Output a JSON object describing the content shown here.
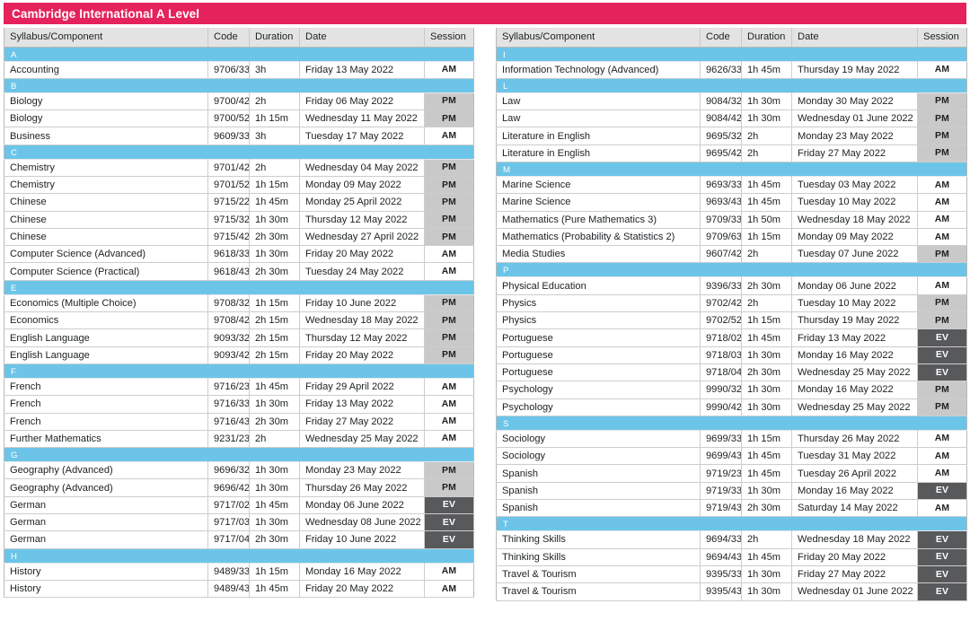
{
  "header": {
    "title": "Cambridge International A Level",
    "accent_pink": "#e5225b",
    "band_blue": "#6cc5e8",
    "session_pm_bg": "#c9c9c9",
    "session_ev_bg": "#58595b"
  },
  "columns": [
    "Syllabus/Component",
    "Code",
    "Duration",
    "Date",
    "Session"
  ],
  "left_table": {
    "sections": [
      {
        "letter": "A",
        "rows": [
          {
            "syllabus": "Accounting",
            "code": "9706/33",
            "duration": "3h",
            "date": "Friday 13 May 2022",
            "session": "AM"
          }
        ]
      },
      {
        "letter": "B",
        "rows": [
          {
            "syllabus": "Biology",
            "code": "9700/42",
            "duration": "2h",
            "date": "Friday 06 May 2022",
            "session": "PM"
          },
          {
            "syllabus": "Biology",
            "code": "9700/52",
            "duration": "1h 15m",
            "date": "Wednesday 11 May 2022",
            "session": "PM"
          },
          {
            "syllabus": "Business",
            "code": "9609/33",
            "duration": "3h",
            "date": "Tuesday 17 May 2022",
            "session": "AM"
          }
        ]
      },
      {
        "letter": "C",
        "rows": [
          {
            "syllabus": "Chemistry",
            "code": "9701/42",
            "duration": "2h",
            "date": "Wednesday 04 May 2022",
            "session": "PM"
          },
          {
            "syllabus": "Chemistry",
            "code": "9701/52",
            "duration": "1h 15m",
            "date": "Monday 09 May 2022",
            "session": "PM"
          },
          {
            "syllabus": "Chinese",
            "code": "9715/22",
            "duration": "1h 45m",
            "date": "Monday 25 April 2022",
            "session": "PM"
          },
          {
            "syllabus": "Chinese",
            "code": "9715/32",
            "duration": "1h 30m",
            "date": "Thursday 12 May 2022",
            "session": "PM"
          },
          {
            "syllabus": "Chinese",
            "code": "9715/42",
            "duration": "2h 30m",
            "date": "Wednesday 27 April 2022",
            "session": "PM"
          },
          {
            "syllabus": "Computer Science (Advanced)",
            "code": "9618/33",
            "duration": "1h 30m",
            "date": "Friday 20 May 2022",
            "session": "AM"
          },
          {
            "syllabus": "Computer Science (Practical)",
            "code": "9618/43",
            "duration": "2h 30m",
            "date": "Tuesday 24 May 2022",
            "session": "AM"
          }
        ]
      },
      {
        "letter": "E",
        "rows": [
          {
            "syllabus": "Economics (Multiple Choice)",
            "code": "9708/32",
            "duration": "1h 15m",
            "date": "Friday 10 June 2022",
            "session": "PM"
          },
          {
            "syllabus": "Economics",
            "code": "9708/42",
            "duration": "2h 15m",
            "date": "Wednesday 18 May 2022",
            "session": "PM"
          },
          {
            "syllabus": "English Language",
            "code": "9093/32",
            "duration": "2h 15m",
            "date": "Thursday 12 May 2022",
            "session": "PM"
          },
          {
            "syllabus": "English Language",
            "code": "9093/42",
            "duration": "2h 15m",
            "date": "Friday 20 May 2022",
            "session": "PM"
          }
        ]
      },
      {
        "letter": "F",
        "rows": [
          {
            "syllabus": "French",
            "code": "9716/23",
            "duration": "1h 45m",
            "date": "Friday 29 April 2022",
            "session": "AM"
          },
          {
            "syllabus": "French",
            "code": "9716/33",
            "duration": "1h 30m",
            "date": "Friday 13 May 2022",
            "session": "AM"
          },
          {
            "syllabus": "French",
            "code": "9716/43",
            "duration": "2h 30m",
            "date": "Friday 27 May 2022",
            "session": "AM"
          },
          {
            "syllabus": "Further Mathematics",
            "code": "9231/23",
            "duration": "2h",
            "date": "Wednesday 25 May 2022",
            "session": "AM"
          }
        ]
      },
      {
        "letter": "G",
        "rows": [
          {
            "syllabus": "Geography (Advanced)",
            "code": "9696/32",
            "duration": "1h 30m",
            "date": "Monday 23 May 2022",
            "session": "PM"
          },
          {
            "syllabus": "Geography (Advanced)",
            "code": "9696/42",
            "duration": "1h 30m",
            "date": "Thursday 26 May 2022",
            "session": "PM"
          },
          {
            "syllabus": "German",
            "code": "9717/02",
            "duration": "1h 45m",
            "date": "Monday 06 June 2022",
            "session": "EV"
          },
          {
            "syllabus": "German",
            "code": "9717/03",
            "duration": "1h 30m",
            "date": "Wednesday 08 June 2022",
            "session": "EV"
          },
          {
            "syllabus": "German",
            "code": "9717/04",
            "duration": "2h 30m",
            "date": "Friday 10 June 2022",
            "session": "EV"
          }
        ]
      },
      {
        "letter": "H",
        "rows": [
          {
            "syllabus": "History",
            "code": "9489/33",
            "duration": "1h 15m",
            "date": "Monday 16 May 2022",
            "session": "AM"
          },
          {
            "syllabus": "History",
            "code": "9489/43",
            "duration": "1h 45m",
            "date": "Friday 20 May 2022",
            "session": "AM"
          }
        ]
      }
    ]
  },
  "right_table": {
    "sections": [
      {
        "letter": "I",
        "rows": [
          {
            "syllabus": "Information Technology (Advanced)",
            "code": "9626/33",
            "duration": "1h 45m",
            "date": "Thursday 19 May 2022",
            "session": "AM"
          }
        ]
      },
      {
        "letter": "L",
        "rows": [
          {
            "syllabus": "Law",
            "code": "9084/32",
            "duration": "1h 30m",
            "date": "Monday 30 May 2022",
            "session": "PM"
          },
          {
            "syllabus": "Law",
            "code": "9084/42",
            "duration": "1h 30m",
            "date": "Wednesday 01 June 2022",
            "session": "PM"
          },
          {
            "syllabus": "Literature in English",
            "code": "9695/32",
            "duration": "2h",
            "date": "Monday 23 May 2022",
            "session": "PM"
          },
          {
            "syllabus": "Literature in English",
            "code": "9695/42",
            "duration": "2h",
            "date": "Friday 27 May 2022",
            "session": "PM"
          }
        ]
      },
      {
        "letter": "M",
        "rows": [
          {
            "syllabus": "Marine Science",
            "code": "9693/33",
            "duration": "1h 45m",
            "date": "Tuesday 03 May 2022",
            "session": "AM"
          },
          {
            "syllabus": "Marine Science",
            "code": "9693/43",
            "duration": "1h 45m",
            "date": "Tuesday 10 May 2022",
            "session": "AM"
          },
          {
            "syllabus": "Mathematics (Pure Mathematics 3)",
            "code": "9709/33",
            "duration": "1h 50m",
            "date": "Wednesday 18 May 2022",
            "session": "AM"
          },
          {
            "syllabus": "Mathematics (Probability & Statistics 2)",
            "code": "9709/63",
            "duration": "1h 15m",
            "date": "Monday 09 May 2022",
            "session": "AM"
          },
          {
            "syllabus": "Media Studies",
            "code": "9607/42",
            "duration": "2h",
            "date": "Tuesday 07 June 2022",
            "session": "PM"
          }
        ]
      },
      {
        "letter": "P",
        "rows": [
          {
            "syllabus": "Physical Education",
            "code": "9396/33",
            "duration": "2h 30m",
            "date": "Monday 06 June 2022",
            "session": "AM"
          },
          {
            "syllabus": "Physics",
            "code": "9702/42",
            "duration": "2h",
            "date": "Tuesday 10 May 2022",
            "session": "PM"
          },
          {
            "syllabus": "Physics",
            "code": "9702/52",
            "duration": "1h 15m",
            "date": "Thursday 19 May 2022",
            "session": "PM"
          },
          {
            "syllabus": "Portuguese",
            "code": "9718/02",
            "duration": "1h 45m",
            "date": "Friday 13 May 2022",
            "session": "EV"
          },
          {
            "syllabus": "Portuguese",
            "code": "9718/03",
            "duration": "1h 30m",
            "date": "Monday 16 May 2022",
            "session": "EV"
          },
          {
            "syllabus": "Portuguese",
            "code": "9718/04",
            "duration": "2h 30m",
            "date": "Wednesday 25 May 2022",
            "session": "EV"
          },
          {
            "syllabus": "Psychology",
            "code": "9990/32",
            "duration": "1h 30m",
            "date": "Monday 16 May 2022",
            "session": "PM"
          },
          {
            "syllabus": "Psychology",
            "code": "9990/42",
            "duration": "1h 30m",
            "date": "Wednesday 25 May 2022",
            "session": "PM"
          }
        ]
      },
      {
        "letter": "S",
        "rows": [
          {
            "syllabus": "Sociology",
            "code": "9699/33",
            "duration": "1h 15m",
            "date": "Thursday 26 May 2022",
            "session": "AM"
          },
          {
            "syllabus": "Sociology",
            "code": "9699/43",
            "duration": "1h 45m",
            "date": "Tuesday 31 May 2022",
            "session": "AM"
          },
          {
            "syllabus": "Spanish",
            "code": "9719/23",
            "duration": "1h 45m",
            "date": "Tuesday 26 April 2022",
            "session": "AM"
          },
          {
            "syllabus": "Spanish",
            "code": "9719/33",
            "duration": "1h 30m",
            "date": "Monday 16 May 2022",
            "session": "EV"
          },
          {
            "syllabus": "Spanish",
            "code": "9719/43",
            "duration": "2h 30m",
            "date": "Saturday 14 May 2022",
            "session": "AM"
          }
        ]
      },
      {
        "letter": "T",
        "rows": [
          {
            "syllabus": "Thinking Skills",
            "code": "9694/33",
            "duration": "2h",
            "date": "Wednesday 18 May 2022",
            "session": "EV"
          },
          {
            "syllabus": "Thinking Skills",
            "code": "9694/43",
            "duration": "1h 45m",
            "date": "Friday 20 May 2022",
            "session": "EV"
          },
          {
            "syllabus": "Travel & Tourism",
            "code": "9395/33",
            "duration": "1h 30m",
            "date": "Friday 27 May 2022",
            "session": "EV"
          },
          {
            "syllabus": "Travel & Tourism",
            "code": "9395/43",
            "duration": "1h 30m",
            "date": "Wednesday 01 June 2022",
            "session": "EV"
          }
        ]
      }
    ]
  }
}
